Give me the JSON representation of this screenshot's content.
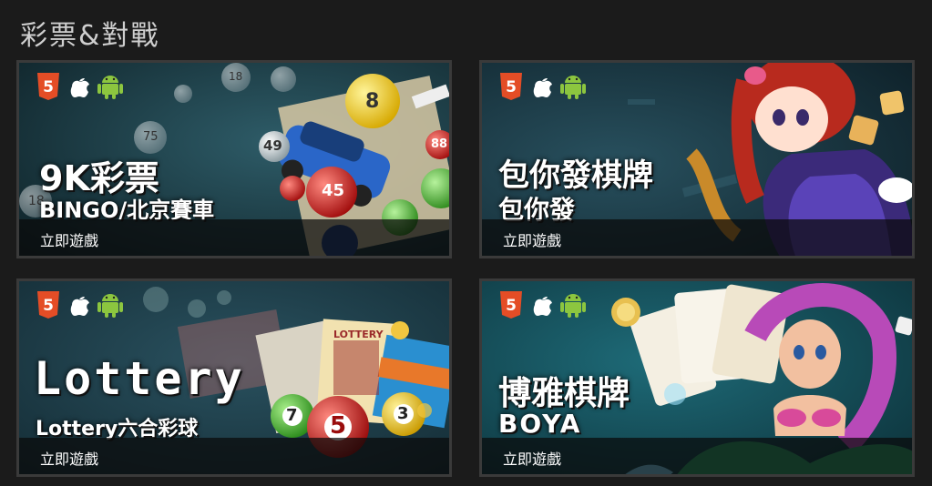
{
  "section": {
    "title": "彩票&對戰"
  },
  "icons": [
    "html5-icon",
    "apple-icon",
    "android-icon"
  ],
  "colors": {
    "html5": "#e44d26",
    "android": "#8cc63f",
    "apple": "#ffffff"
  },
  "cards": [
    {
      "title": "9K彩票",
      "subtitle": "BINGO/北京賽車",
      "play_label": "立即遊戲",
      "ball_numbers": [
        "18",
        "75",
        "49",
        "8",
        "88",
        "45",
        "18"
      ]
    },
    {
      "title": "包你發棋牌",
      "subtitle": "包你發",
      "play_label": "立即遊戲"
    },
    {
      "title": "Lottery",
      "subtitle": "Lottery六合彩球",
      "play_label": "立即遊戲",
      "ticket_label": "LOTTERY",
      "ball_numbers": [
        "7",
        "5",
        "3"
      ]
    },
    {
      "title": "博雅棋牌",
      "subtitle": "BOYA",
      "play_label": "立即遊戲"
    }
  ]
}
